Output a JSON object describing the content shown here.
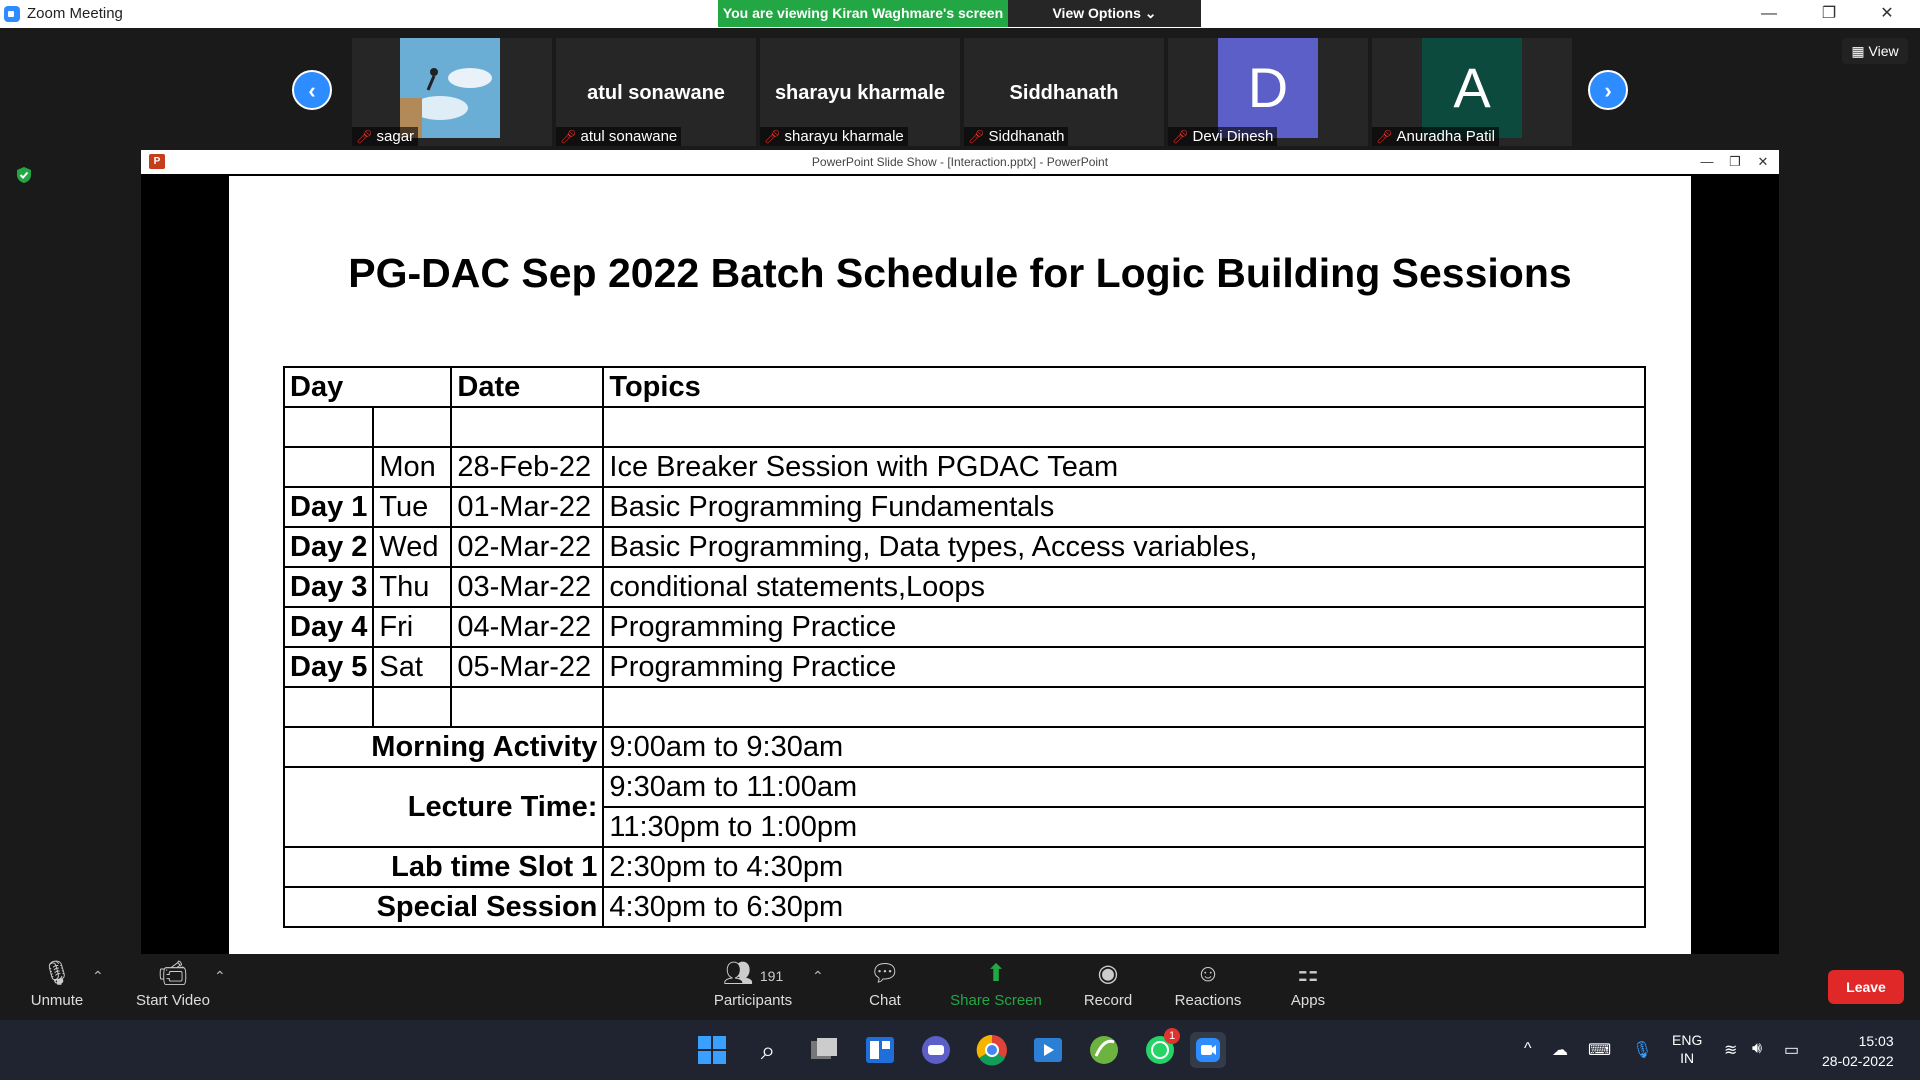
{
  "window": {
    "app_title": "Zoom Meeting",
    "viewing_banner": "You are viewing Kiran Waghmare's screen",
    "view_options": "View Options ⌄",
    "minimize": "—",
    "restore": "❐",
    "close": "✕"
  },
  "participants": {
    "view_label": "View",
    "tiles": [
      {
        "name": "sagar",
        "big": "",
        "type": "image"
      },
      {
        "name": "atul sonawane",
        "big": "atul sonawane",
        "type": "text"
      },
      {
        "name": "sharayu kharmale",
        "big": "sharayu kharmale",
        "type": "text"
      },
      {
        "name": "Siddhanath",
        "big": "Siddhanath",
        "type": "text"
      },
      {
        "name": "Devi Dinesh",
        "big": "D",
        "type": "avatar",
        "color": "#5b5fc7"
      },
      {
        "name": "Anuradha Patil",
        "big": "A",
        "type": "avatar",
        "color": "#0d4a3e"
      }
    ]
  },
  "ppt": {
    "title": "PowerPoint Slide Show - [Interaction.pptx] - PowerPoint",
    "icon": "P",
    "minimize": "—",
    "restore": "❐",
    "close": "✕"
  },
  "slide": {
    "title": "PG-DAC Sep 2022 Batch Schedule for Logic Building Sessions",
    "headers": {
      "day": "Day",
      "date": "Date",
      "topics": "Topics"
    },
    "rows": [
      {
        "day": "",
        "weekday": "Mon",
        "date": "28-Feb-22",
        "topic": "Ice Breaker Session with PGDAC Team"
      },
      {
        "day": "Day 1",
        "weekday": "Tue",
        "date": "01-Mar-22",
        "topic": "Basic Programming Fundamentals"
      },
      {
        "day": "Day 2",
        "weekday": "Wed",
        "date": "02-Mar-22",
        "topic": "Basic Programming, Data types, Access variables,"
      },
      {
        "day": "Day 3",
        "weekday": "Thu",
        "date": "03-Mar-22",
        "topic": "conditional statements,Loops"
      },
      {
        "day": "Day 4",
        "weekday": "Fri",
        "date": "04-Mar-22",
        "topic": "Programming Practice"
      },
      {
        "day": "Day 5",
        "weekday": "Sat",
        "date": "05-Mar-22",
        "topic": "Programming Practice"
      }
    ],
    "timings": {
      "morning_label": "Morning Activity",
      "morning_time": "9:00am to 9:30am",
      "lecture_label": "Lecture Time:",
      "lecture_time_1": "9:30am to 11:00am",
      "lecture_time_2": "11:30pm to 1:00pm",
      "lab_label": "Lab time Slot 1",
      "lab_time": "2:30pm to 4:30pm",
      "special_label": "Special  Session",
      "special_time": "4:30pm to 6:30pm"
    }
  },
  "toolbar": {
    "unmute": "Unmute",
    "start_video": "Start Video",
    "participants_count": "191",
    "participants": "Participants",
    "chat": "Chat",
    "share_screen": "Share Screen",
    "record": "Record",
    "reactions": "Reactions",
    "apps": "Apps",
    "leave": "Leave"
  },
  "taskbar": {
    "lang_1": "ENG",
    "lang_2": "IN",
    "time": "15:03",
    "date": "28-02-2022",
    "whatsapp_badge": "1"
  }
}
